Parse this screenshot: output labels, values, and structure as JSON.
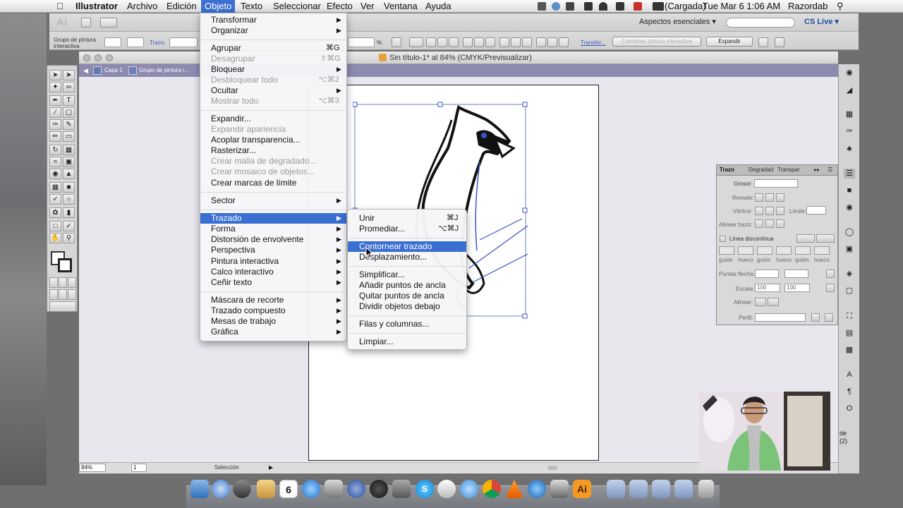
{
  "menubar": {
    "app": "Illustrator",
    "items": [
      "Archivo",
      "Edición",
      "Objeto",
      "Texto",
      "Seleccionar",
      "Efecto",
      "Ver",
      "Ventana",
      "Ayuda"
    ],
    "active": "Objeto",
    "battery": "(Cargada)",
    "clock": "Tue Mar 6  1:06 AM",
    "user": "Razordab"
  },
  "controlbar": {
    "ai_label": "Ai",
    "selection_label": "Grupo de pintura interactiva",
    "stroke_label": "Trazo:",
    "percent": "%",
    "transform_link": "Transfor...",
    "merge_button": "Combinar pintura interactiva",
    "expand_button": "Expandir",
    "workspace": "Aspectos esenciales ▾",
    "search_placeholder": "",
    "cslive": "CS Live ▾"
  },
  "document": {
    "title": "Sin título-1* al 84% (CMYK/Previsualizar)",
    "layer": "Capa 1",
    "group": "Grupo de pintura i..."
  },
  "statusbar": {
    "zoom": "84%",
    "page": "1",
    "mode": "Selección"
  },
  "objeto_menu": {
    "items": [
      {
        "label": "Transformar",
        "submenu": true
      },
      {
        "label": "Organizar",
        "submenu": true
      },
      {
        "label": "Agrupar",
        "shortcut": "⌘G"
      },
      {
        "label": "Desagrupar",
        "shortcut": "⇧⌘G",
        "disabled": true
      },
      {
        "label": "Bloquear",
        "submenu": true
      },
      {
        "label": "Desbloquear todo",
        "shortcut": "⌥⌘2",
        "disabled": true
      },
      {
        "label": "Ocultar",
        "submenu": true
      },
      {
        "label": "Mostrar todo",
        "shortcut": "⌥⌘3",
        "disabled": true
      },
      {
        "label": "Expandir..."
      },
      {
        "label": "Expandir apariencia",
        "disabled": true
      },
      {
        "label": "Acoplar transparencia..."
      },
      {
        "label": "Rasterizar..."
      },
      {
        "label": "Crear malla de degradado...",
        "disabled": true
      },
      {
        "label": "Crear mosaico de objetos...",
        "disabled": true
      },
      {
        "label": "Crear marcas de límite"
      },
      {
        "label": "Sector",
        "submenu": true
      },
      {
        "label": "Trazado",
        "submenu": true,
        "highlighted": true
      },
      {
        "label": "Forma",
        "submenu": true
      },
      {
        "label": "Distorsión de envolvente",
        "submenu": true
      },
      {
        "label": "Perspectiva",
        "submenu": true
      },
      {
        "label": "Pintura interactiva",
        "submenu": true
      },
      {
        "label": "Calco interactivo",
        "submenu": true
      },
      {
        "label": "Ceñir texto",
        "submenu": true
      },
      {
        "label": "Máscara de recorte",
        "submenu": true
      },
      {
        "label": "Trazado compuesto",
        "submenu": true
      },
      {
        "label": "Mesas de trabajo",
        "submenu": true
      },
      {
        "label": "Gráfica",
        "submenu": true
      }
    ]
  },
  "trazado_menu": {
    "items": [
      {
        "label": "Unir",
        "shortcut": "⌘J"
      },
      {
        "label": "Promediar...",
        "shortcut": "⌥⌘J"
      },
      {
        "label": "Contornear trazado",
        "highlighted": true
      },
      {
        "label": "Desplazamiento..."
      },
      {
        "label": "Simplificar..."
      },
      {
        "label": "Añadir puntos de ancla"
      },
      {
        "label": "Quitar puntos de ancla"
      },
      {
        "label": "Dividir objetos debajo"
      },
      {
        "label": "Filas y columnas..."
      },
      {
        "label": "Limpiar..."
      }
    ]
  },
  "stroke_panel": {
    "tabs": [
      "Trazo",
      "Degradad",
      "Transpar"
    ],
    "grosor": "Grosor:",
    "remate": "Remate:",
    "vertice": "Vértice:",
    "limite": "Límite:",
    "alinear_trazo": "Alinear trazo:",
    "linea_discontinua": "Línea discontinua",
    "dash_labels": [
      "guión",
      "hueco",
      "guión",
      "hueco",
      "guión",
      "hueco"
    ],
    "puntas_flecha": "Puntas flecha:",
    "escala": "Escala:",
    "escala_a": "100",
    "escala_b": "100",
    "alinear": "Alinear:",
    "perfil": "Perfil:"
  },
  "right_overflow": {
    "line1": "de",
    "line2": "(2)"
  },
  "dock_icons": [
    "finder",
    "safari",
    "itunes",
    "calendar",
    "appstore",
    "photos",
    "music",
    "ical",
    "chess",
    "skype",
    "stormtrooper",
    "messages",
    "chrome",
    "vlc",
    "ie",
    "preview",
    "illustrator",
    "folder",
    "apps",
    "docs",
    "downloads",
    "trash"
  ],
  "colors": {
    "menu_highlight": "#3a6fd2",
    "breadcrumb_bar": "#8d8ab0",
    "selection_path": "#3b52c4"
  }
}
